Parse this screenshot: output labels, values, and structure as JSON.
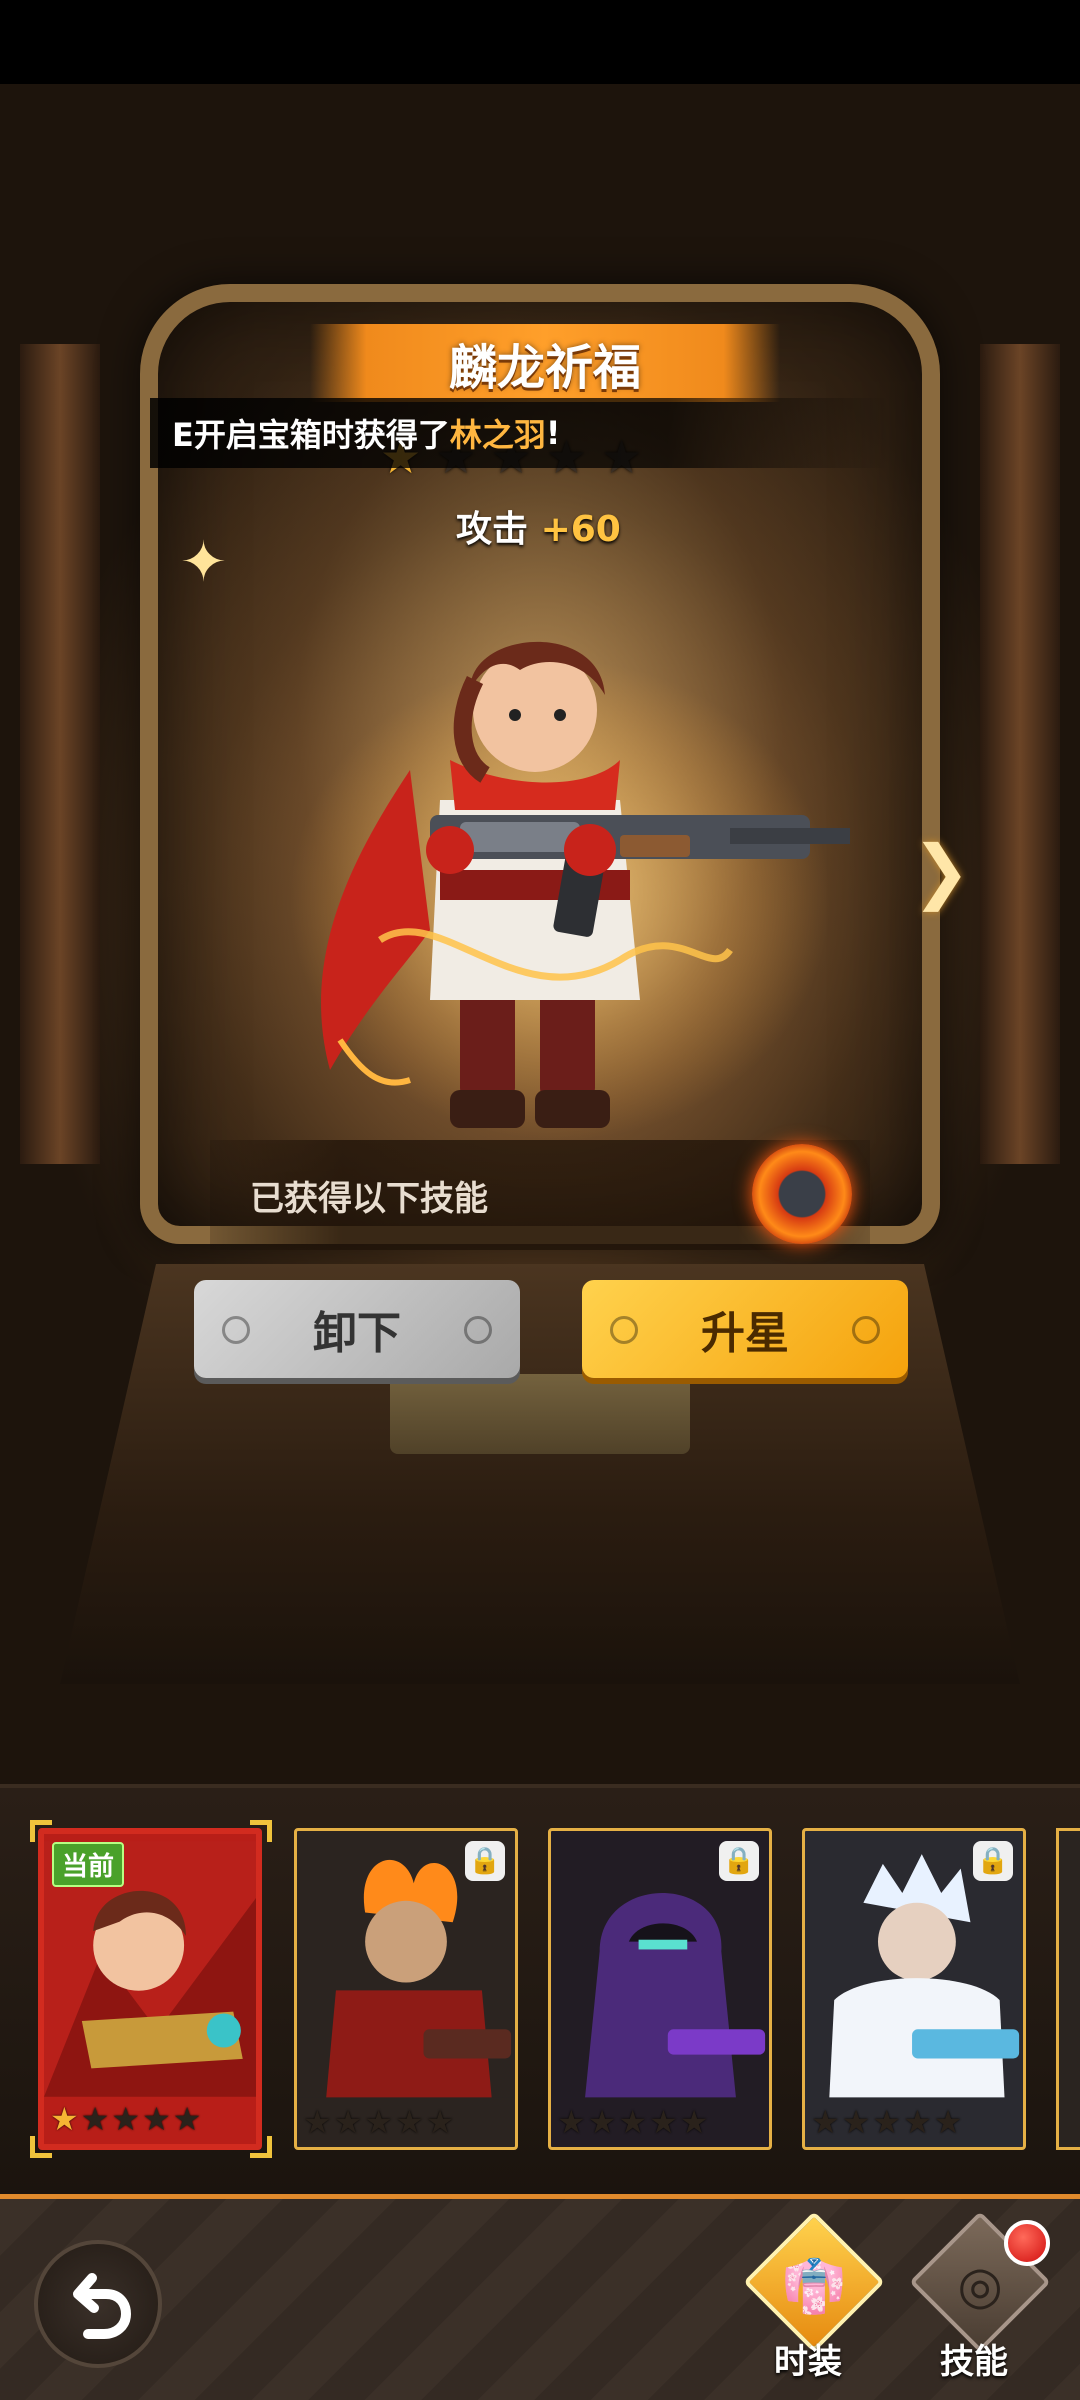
{
  "title": "麟龙祈福",
  "toast": {
    "prefix": "E开启宝箱时获得了",
    "hero_name": "林之羽",
    "suffix": "!"
  },
  "hero_stars": {
    "filled": 1,
    "total": 5
  },
  "attack": {
    "label": "攻击",
    "value": "+60"
  },
  "skills_label": "已获得以下技能",
  "buttons": {
    "unequip": "卸下",
    "star_up": "升星"
  },
  "roster": [
    {
      "badge": "当前",
      "stars_filled": 1,
      "locked": false,
      "theme": "red"
    },
    {
      "stars_filled": 0,
      "locked": true,
      "theme": "fire"
    },
    {
      "stars_filled": 0,
      "locked": true,
      "theme": "shadow"
    },
    {
      "stars_filled": 0,
      "locked": true,
      "theme": "ice"
    }
  ],
  "nav": {
    "costume": "时装",
    "skill": "技能"
  },
  "icons": {
    "back": "back-arrow-icon",
    "next": "chevron-right-icon",
    "lock": "lock-icon",
    "costume": "costume-icon",
    "skill": "skill-icon"
  },
  "colors": {
    "accent": "#f08a1c",
    "highlight": "#ffb640",
    "star": "#f6b533"
  }
}
